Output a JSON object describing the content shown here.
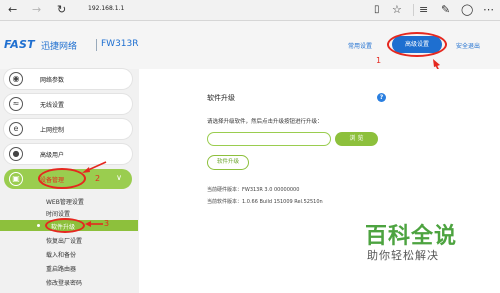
{
  "browser": {
    "url": "192.168.1.1",
    "icons": [
      "back-icon",
      "forward-icon",
      "refresh-icon",
      "reading-view-icon",
      "favorite-star-icon",
      "favorites-hub-icon",
      "note-icon",
      "share-icon"
    ]
  },
  "header": {
    "logo_brand": "FAST",
    "logo_cn": "迅捷网络",
    "model": "FW313R",
    "links": {
      "common": "常用设置",
      "advanced": "高级设置",
      "logout": "安全退出"
    }
  },
  "annotations": {
    "step1": "1",
    "step2": "2",
    "step3": "3",
    "color": "#e5281f"
  },
  "sidebar": {
    "items": [
      {
        "label": "网络参数",
        "icon": "globe-icon"
      },
      {
        "label": "无线设置",
        "icon": "wifi-icon"
      },
      {
        "label": "上网控制",
        "icon": "ie-icon"
      },
      {
        "label": "高级用户",
        "icon": "user-icon"
      },
      {
        "label": "设备管理",
        "icon": "device-icon"
      }
    ],
    "sub_items": [
      "WEB管理设置",
      "时间设置",
      "软件升级",
      "恢复出厂设置",
      "载入和备份",
      "重启路由器",
      "修改登录密码"
    ],
    "active_sub": "软件升级"
  },
  "main": {
    "title": "软件升级",
    "instruction": "请选择升级软件，然后点击升级按钮进行升级：",
    "file_value": "",
    "browse_label": "浏 览",
    "upgrade_label": "软件升级",
    "hw_version": "当前硬件版本：FW313R 3.0 00000000",
    "sw_version": "当前软件版本：1.0.66 Build 151009 Rel.52510n"
  },
  "watermark": {
    "big": "百科全说",
    "small": "助你轻松解决"
  },
  "colors": {
    "brand_blue": "#1e6fd0",
    "green": "#8dc03c",
    "annotation_red": "#e5281f"
  }
}
